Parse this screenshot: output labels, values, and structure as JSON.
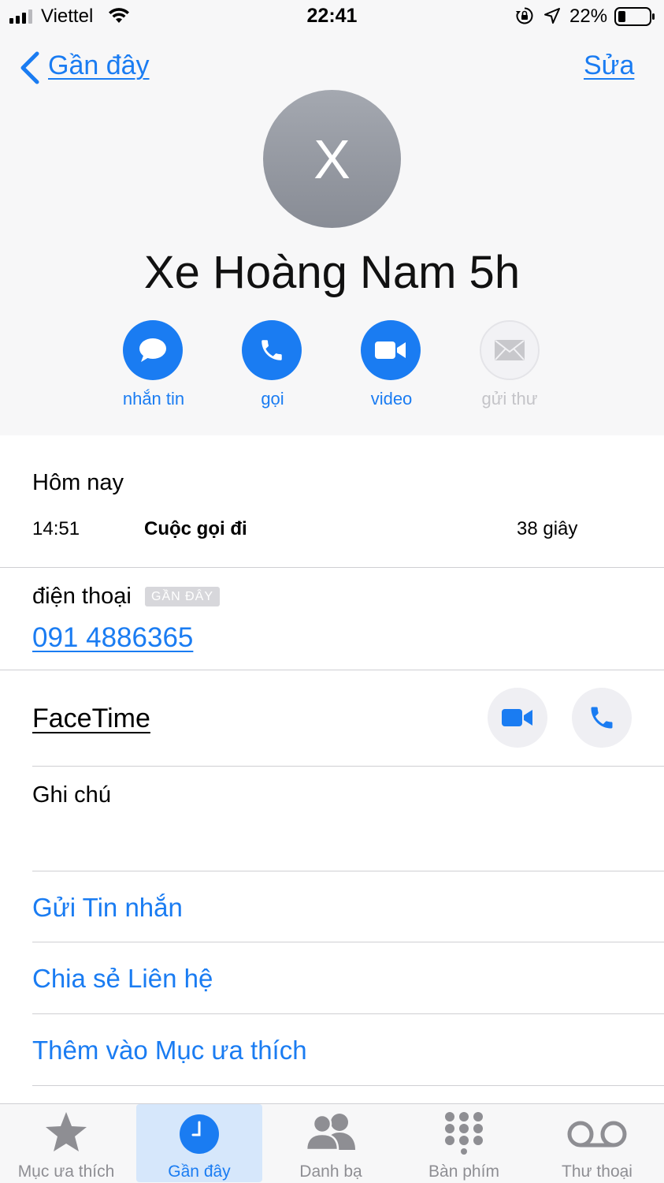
{
  "status_bar": {
    "carrier": "Viettel",
    "time": "22:41",
    "battery": "22%"
  },
  "nav": {
    "back_label": "Gần đây",
    "edit_label": "Sửa"
  },
  "contact": {
    "initial": "X",
    "name": "Xe Hoàng Nam 5h"
  },
  "actions": [
    {
      "label": "nhắn tin",
      "icon": "message-icon",
      "enabled": true
    },
    {
      "label": "gọi",
      "icon": "phone-icon",
      "enabled": true
    },
    {
      "label": "video",
      "icon": "video-icon",
      "enabled": true
    },
    {
      "label": "gửi thư",
      "icon": "mail-icon",
      "enabled": false
    }
  ],
  "recent": {
    "section_title": "Hôm nay",
    "time": "14:51",
    "type": "Cuộc gọi đi",
    "duration": "38 giây"
  },
  "phone": {
    "label": "điện thoại",
    "badge": "GẦN ĐÂY",
    "number": "091 4886365"
  },
  "facetime": {
    "label": "FaceTime"
  },
  "notes": {
    "label": "Ghi chú"
  },
  "links": {
    "send_message": "Gửi Tin nhắn",
    "share_contact": "Chia sẻ Liên hệ",
    "add_favorite": "Thêm vào Mục ưa thích"
  },
  "tabs": [
    {
      "label": "Mục ưa thích",
      "icon": "star-icon",
      "active": false
    },
    {
      "label": "Gần đây",
      "icon": "clock-icon",
      "active": true
    },
    {
      "label": "Danh bạ",
      "icon": "contacts-icon",
      "active": false
    },
    {
      "label": "Bàn phím",
      "icon": "keypad-icon",
      "active": false
    },
    {
      "label": "Thư thoại",
      "icon": "voicemail-icon",
      "active": false
    }
  ],
  "colors": {
    "accent": "#1a7cf2",
    "header_bg": "#f7f7f8",
    "separator": "#cfcfd3",
    "inactive": "#8e8e93"
  }
}
